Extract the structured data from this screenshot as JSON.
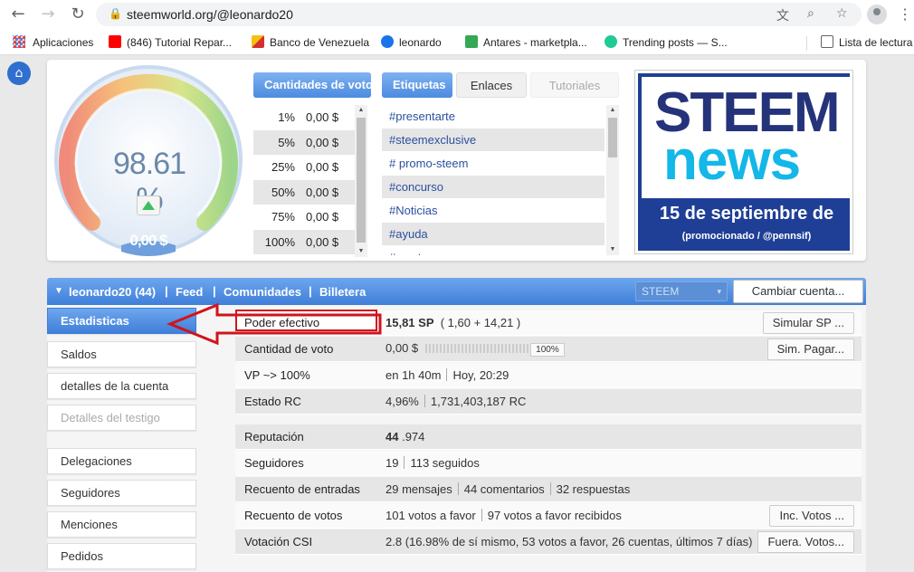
{
  "browser": {
    "url": "steemworld.org/@leonardo20",
    "bookmarks": [
      {
        "label": "Aplicaciones"
      },
      {
        "label": "(846) Tutorial Repar..."
      },
      {
        "label": "Banco de Venezuela"
      },
      {
        "label": "leonardo"
      },
      {
        "label": "Antares - marketpla..."
      },
      {
        "label": "Trending posts — S..."
      },
      {
        "label": "Lista de lectura"
      }
    ]
  },
  "gauge": {
    "percent": "98.61 %",
    "value": "0,00 $",
    "level": 0.9861
  },
  "vote_box": {
    "title": "Cantidades de voto",
    "rows": [
      {
        "pct": "1%",
        "amount": "0,00 $"
      },
      {
        "pct": "5%",
        "amount": "0,00 $"
      },
      {
        "pct": "25%",
        "amount": "0,00 $"
      },
      {
        "pct": "50%",
        "amount": "0,00 $"
      },
      {
        "pct": "75%",
        "amount": "0,00 $"
      },
      {
        "pct": "100%",
        "amount": "0,00 $"
      }
    ]
  },
  "tags_box": {
    "tabs": [
      "Etiquetas",
      "Enlaces",
      "Tutoriales"
    ],
    "tags": [
      "#presentarte",
      "#steemexclusive",
      "# promo-steem",
      "#concurso",
      "#Noticias",
      "#ayuda",
      "#crypto"
    ]
  },
  "news": {
    "line1": "STEEM",
    "line2": "news",
    "date": "15 de septiembre de",
    "sub": "(promocionado / @pennsif)"
  },
  "account_bar": {
    "account": "leonardo20 (44)",
    "feed": "Feed",
    "communities": "Comunidades",
    "wallet": "Billetera",
    "token": "STEEM",
    "switch": "Cambiar cuenta..."
  },
  "sidebar": {
    "items": [
      "Estadisticas",
      "Saldos",
      "detalles de la cuenta",
      "Detalles del testigo",
      "Delegaciones",
      "Seguidores",
      "Menciones",
      "Pedidos"
    ]
  },
  "stats": {
    "poder_label": "Poder efectivo",
    "poder_main": "15,81 SP",
    "poder_detail": "( 1,60 + 14,21 )",
    "poder_btn": "Simular SP ...",
    "cantidad_label": "Cantidad de voto",
    "cantidad_val": "0,00 $",
    "cantidad_pct": "100%",
    "cantidad_btn": "Sim. Pagar...",
    "vp_label": "VP ~> 100%",
    "vp_a": "en 1h 40m",
    "vp_b": "Hoy, 20:29",
    "rc_label": "Estado RC",
    "rc_a": "4,96%",
    "rc_b": "1,731,403,187 RC",
    "rep_label": "Reputación",
    "rep_main": "44",
    "rep_dec": ".974",
    "seg_label": "Seguidores",
    "seg_a": "19",
    "seg_b": "113 seguidos",
    "rec_label": "Recuento de entradas",
    "rec_a": "29 mensajes",
    "rec_b": "44 comentarios",
    "rec_c": "32 respuestas",
    "votos_label": "Recuento de votos",
    "votos_a": "101 votos a favor",
    "votos_b": "97 votos a favor recibidos",
    "votos_btn": "Inc. Votos ...",
    "csi_label": "Votación CSI",
    "csi_main": "2.8",
    "csi_detail": "(16.98% de sí mismo, 53 votos a favor, 26 cuentas, últimos 7 días)",
    "csi_btn": "Fuera. Votos..."
  },
  "colors": {
    "accent": "#4c8be0",
    "annotation": "#d0141c",
    "news_bg": "#1e3f95",
    "news_cyan": "#13b7e8"
  }
}
